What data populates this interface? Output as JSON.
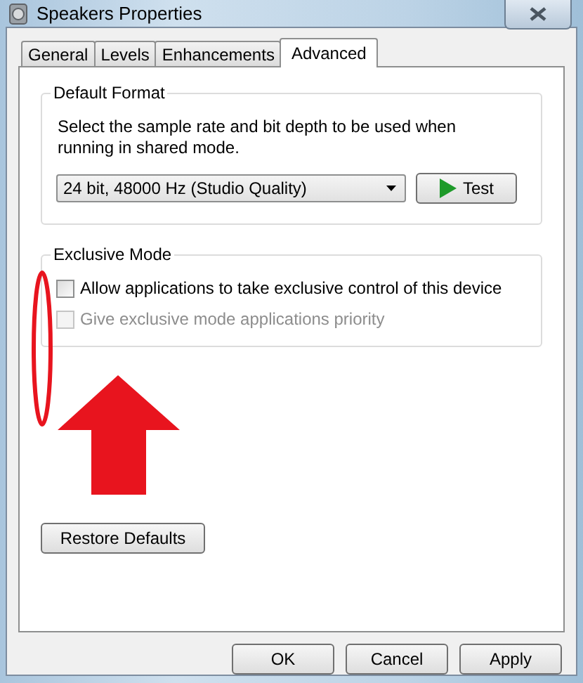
{
  "window": {
    "title": "Speakers Properties"
  },
  "tabs": [
    {
      "label": "General",
      "selected": false
    },
    {
      "label": "Levels",
      "selected": false
    },
    {
      "label": "Enhancements",
      "selected": false
    },
    {
      "label": "Advanced",
      "selected": true
    }
  ],
  "default_format": {
    "title": "Default Format",
    "description": "Select the sample rate and bit depth to be used when running in shared mode.",
    "format": "24 bit, 48000 Hz (Studio Quality)",
    "test_button": "Test"
  },
  "exclusive_mode": {
    "title": "Exclusive Mode",
    "options": [
      {
        "label": "Allow applications to take exclusive control of this device",
        "checked": false,
        "disabled": false
      },
      {
        "label": "Give exclusive mode applications priority",
        "checked": false,
        "disabled": true
      }
    ]
  },
  "restore_button": "Restore Defaults",
  "buttons": [
    "OK",
    "Cancel",
    "Apply"
  ]
}
